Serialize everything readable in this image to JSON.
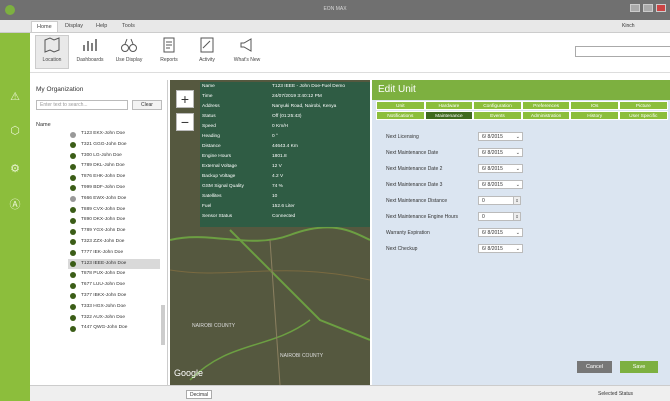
{
  "window": {
    "title": "EON MAX",
    "user": "Kinch"
  },
  "menu": [
    "Home",
    "Display",
    "Help",
    "Tools"
  ],
  "toolbar": [
    {
      "label": "Location",
      "icon": "map-icon"
    },
    {
      "label": "Dashboards",
      "icon": "bar-chart-icon"
    },
    {
      "label": "Use Display",
      "icon": "binoculars-icon"
    },
    {
      "label": "Reports",
      "icon": "report-icon"
    },
    {
      "label": "Activity",
      "icon": "activity-icon"
    },
    {
      "label": "What's New",
      "icon": "megaphone-icon"
    }
  ],
  "sidebar": {
    "title": "My Organization",
    "search_placeholder": "Enter text to search...",
    "clear_label": "Clear",
    "name_header": "Name",
    "vehicles": [
      "T123 EKX-John Doe",
      "T321 GGG-John Doe",
      "T300 LG-John Doe",
      "T789 DKL-John Doe",
      "T876 EHK-John Doe",
      "T999 BDF-John Doe",
      "T666 EWX-John Doe",
      "T889 CVX-John Doe",
      "T890 DKX-John Doe",
      "T789 YGX-John Doe",
      "T323 ZZX-John Doe",
      "T777 IEK-John Doe",
      "T123 IEEE-John Doe",
      "T878 PUX-John Doe",
      "T677 LUU-John Doe",
      "T377 IBKX-John Doe",
      "T333 HGX-John Doe",
      "T322 AUX-John Doe",
      "T447 QWG-John Doe"
    ]
  },
  "info": {
    "rows": [
      [
        "Name",
        "T123 IEEE - John Doe-Fuel Demo"
      ],
      [
        "Time",
        "24/07/2019 3:40:12 PM"
      ],
      [
        "Address",
        "Nanyuki Road, Nairobi, Kenya"
      ],
      [
        "Status",
        "Off (01:25:43)"
      ],
      [
        "Speed",
        "0 Km/H"
      ],
      [
        "Heading",
        "0 °"
      ],
      [
        "Distance",
        "44643.4 Km"
      ],
      [
        "Engine Hours",
        "1801.8"
      ],
      [
        "External Voltage",
        "12 V"
      ],
      [
        "Backup Voltage",
        "4.2 V"
      ],
      [
        "GSM Signal Quality",
        "74 %"
      ],
      [
        "Satellites",
        "10"
      ],
      [
        "Fuel",
        "152.6 Liter"
      ],
      [
        "Sensor Status",
        "Connected"
      ]
    ]
  },
  "map": {
    "labels": [
      "NAIROBI COUNTY",
      "NAIROBI COUNTY"
    ],
    "provider": "Google"
  },
  "edit": {
    "title": "Edit Unit",
    "tabs_row1": [
      "Unit",
      "Hardware",
      "Configuration",
      "Preferences",
      "IOs",
      "Picture"
    ],
    "tabs_row2": [
      "Notifications",
      "Maintenance",
      "Events",
      "Administration",
      "History",
      "User Specific"
    ],
    "fields": [
      {
        "label": "Next Licensing",
        "value": "6/ 8/2015"
      },
      {
        "label": "Next Maintenance Date",
        "value": "6/ 8/2015"
      },
      {
        "label": "Next Maintenance Date 2",
        "value": "6/ 8/2015"
      },
      {
        "label": "Next Maintenance Date 3",
        "value": "6/ 8/2015"
      },
      {
        "label": "Next Maintenance Distance",
        "value": "0"
      },
      {
        "label": "Next Maintenance Engine Hours",
        "value": "0"
      },
      {
        "label": "Warranty Expiration",
        "value": "6/ 8/2015"
      },
      {
        "label": "Next Checkup",
        "value": "6/ 8/2015"
      }
    ],
    "cancel": "Cancel",
    "save": "Save"
  },
  "status": {
    "decimal": "Decimal",
    "selected_status": "Selected Status"
  }
}
